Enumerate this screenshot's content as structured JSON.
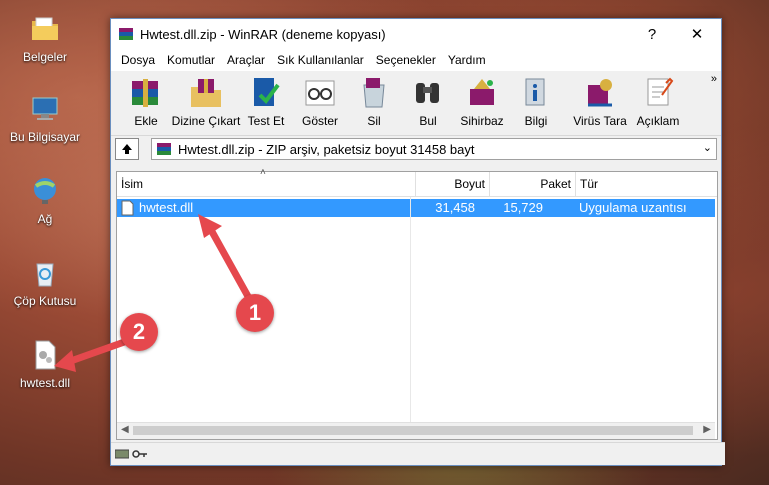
{
  "desktop": {
    "icons": [
      {
        "label": "Belgeler"
      },
      {
        "label": "Bu Bilgisayar"
      },
      {
        "label": "Ağ"
      },
      {
        "label": "Çöp Kutusu"
      },
      {
        "label": "hwtest.dll"
      }
    ]
  },
  "window": {
    "title": "Hwtest.dll.zip - WinRAR (deneme kopyası)",
    "help_label": "?",
    "close_label": "✕"
  },
  "menu": [
    "Dosya",
    "Komutlar",
    "Araçlar",
    "Sık Kullanılanlar",
    "Seçenekler",
    "Yardım"
  ],
  "toolbar": {
    "buttons": [
      "Ekle",
      "Dizine Çıkart",
      "Test Et",
      "Göster",
      "Sil",
      "Bul",
      "Sihirbaz",
      "Bilgi",
      "Virüs Tara",
      "Açıklam"
    ],
    "more": "»"
  },
  "address": {
    "text": "Hwtest.dll.zip - ZIP arşiv, paketsiz boyut 31458 bayt"
  },
  "file_list": {
    "columns": [
      "İsim",
      "Boyut",
      "Paket",
      "Tür"
    ],
    "rows": [
      {
        "name": "hwtest.dll",
        "size": "31,458",
        "packed": "15,729",
        "type": "Uygulama uzantısı"
      }
    ]
  },
  "callouts": [
    "1",
    "2"
  ],
  "colors": {
    "selection": "#3399ff",
    "callout": "#e5484d"
  }
}
